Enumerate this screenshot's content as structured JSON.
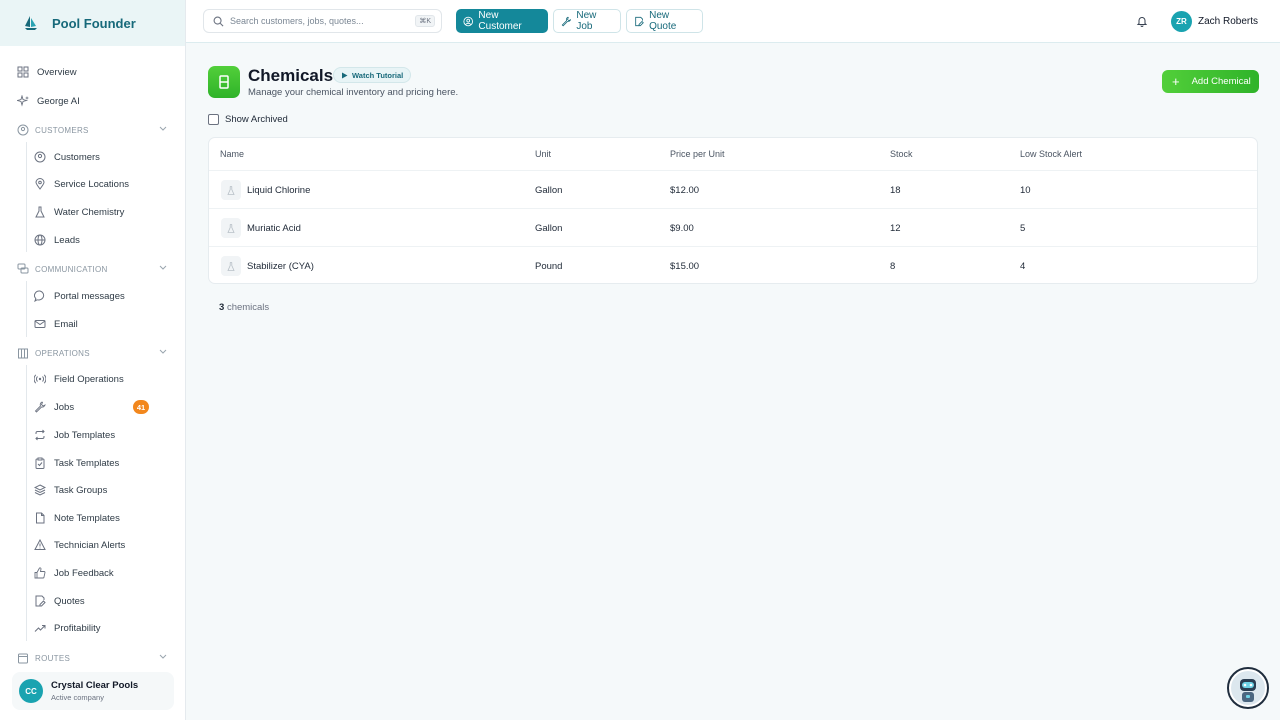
{
  "brand": {
    "name": "Pool Founder"
  },
  "search": {
    "placeholder": "Search customers, jobs, quotes...",
    "shortcut": "⌘K"
  },
  "topbar": {
    "new_customer": "New Customer",
    "new_job": "New Job",
    "new_quote": "New Quote",
    "user_initials": "ZR",
    "user_name": "Zach Roberts"
  },
  "sidebar": {
    "overview": "Overview",
    "george_ai": "George AI",
    "customers_section": "CUSTOMERS",
    "customers_items": [
      "Customers",
      "Service Locations",
      "Water Chemistry",
      "Leads"
    ],
    "communication_section": "COMMUNICATION",
    "communication_items": [
      "Portal messages",
      "Email"
    ],
    "operations_section": "OPERATIONS",
    "operations_items": [
      "Field Operations",
      "Jobs",
      "Job Templates",
      "Task Templates",
      "Task Groups",
      "Note Templates",
      "Technician Alerts",
      "Job Feedback",
      "Quotes",
      "Profitability"
    ],
    "jobs_badge": "41",
    "routes_section": "ROUTES",
    "company_initials": "CC",
    "company_name": "Crystal Clear Pools",
    "company_sub": "Active company"
  },
  "page": {
    "title": "Chemicals",
    "tutorial": "Watch Tutorial",
    "subtitle": "Manage your chemical inventory and pricing here.",
    "add_button": "Add Chemical",
    "show_archived": "Show Archived"
  },
  "table": {
    "headers": [
      "Name",
      "Unit",
      "Price per Unit",
      "Stock",
      "Low Stock Alert"
    ],
    "rows": [
      [
        "Liquid Chlorine",
        "Gallon",
        "$12.00",
        "18",
        "10"
      ],
      [
        "Muriatic Acid",
        "Gallon",
        "$9.00",
        "12",
        "5"
      ],
      [
        "Stabilizer (CYA)",
        "Pound",
        "$15.00",
        "8",
        "4"
      ]
    ]
  },
  "footer": {
    "count": "3",
    "count_label": "chemicals"
  },
  "colors": {
    "teal": "#14889a",
    "green": "#2fb329",
    "badge": "#f2871d"
  }
}
